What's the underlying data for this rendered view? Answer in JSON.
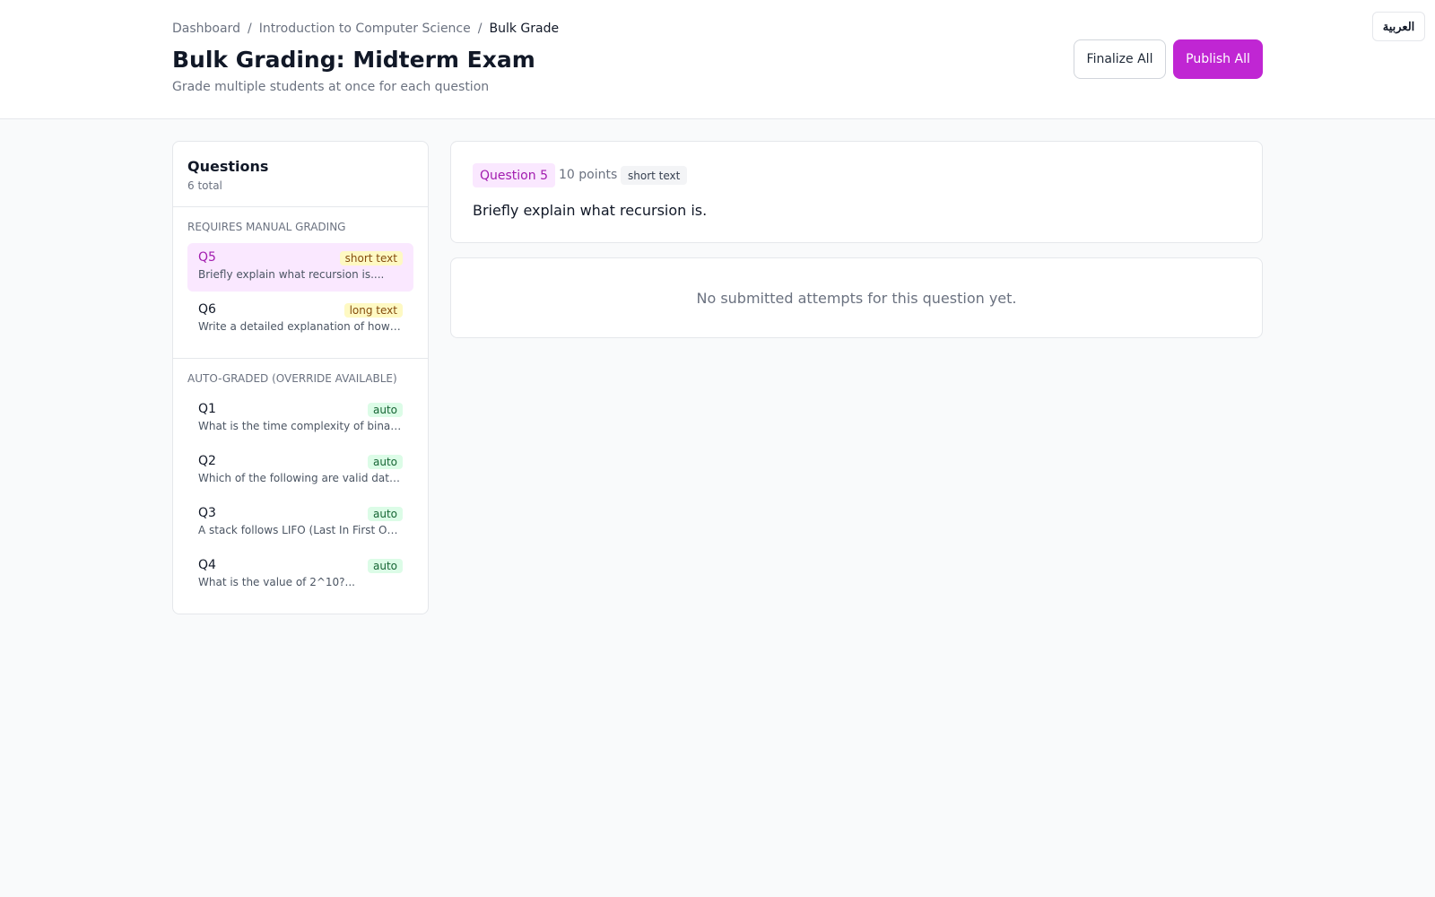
{
  "breadcrumb": {
    "items": [
      "Dashboard",
      "Introduction to Computer Science"
    ],
    "current": "Bulk Grade",
    "separator": "/"
  },
  "header": {
    "title": "Bulk Grading: Midterm Exam",
    "subtitle": "Grade multiple students at once for each question",
    "finalize_label": "Finalize All",
    "publish_label": "Publish All",
    "language_label": "العربية"
  },
  "sidebar": {
    "title": "Questions",
    "count": "6 total",
    "manual_section": {
      "label": "Requires Manual Grading",
      "items": [
        {
          "id": "Q5",
          "badge": "short text",
          "snippet": "Briefly explain what recursion is....",
          "active": true
        },
        {
          "id": "Q6",
          "badge": "long text",
          "snippet": "Write a detailed explanation of how a ...",
          "active": false
        }
      ]
    },
    "auto_section": {
      "label": "Auto-Graded (Override Available)",
      "items": [
        {
          "id": "Q1",
          "badge": "auto",
          "snippet": "What is the time complexity of binary s..."
        },
        {
          "id": "Q2",
          "badge": "auto",
          "snippet": "Which of the following are valid data ty..."
        },
        {
          "id": "Q3",
          "badge": "auto",
          "snippet": "A stack follows LIFO (Last In First Out)..."
        },
        {
          "id": "Q4",
          "badge": "auto",
          "snippet": "What is the value of 2^10?..."
        }
      ]
    }
  },
  "question": {
    "tag": "Question 5",
    "points": "10 points",
    "type": "short text",
    "text": "Briefly explain what recursion is."
  },
  "empty_state": "No submitted attempts for this question yet.",
  "colors": {
    "accent": "#c026d3",
    "accent_light": "#fae8ff",
    "badge_yellow": "#fef9c3",
    "badge_green": "#dcfce7"
  }
}
